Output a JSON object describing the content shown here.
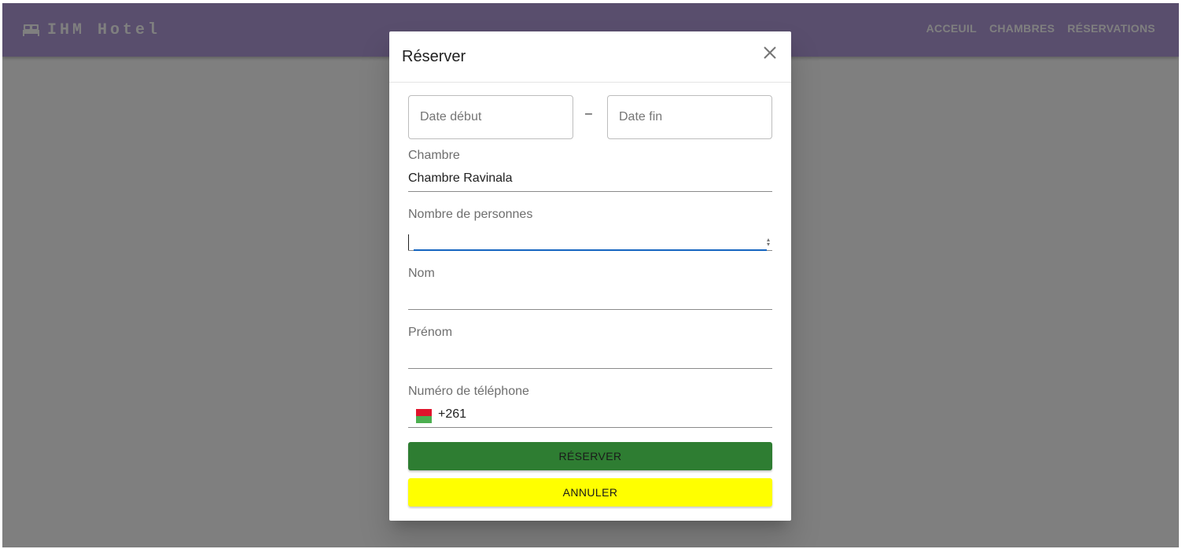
{
  "app": {
    "brand_icon": "bed-icon",
    "title": "IHM Hotel",
    "nav": [
      "ACCEUIL",
      "CHAMBRES",
      "RÉSERVATIONS"
    ]
  },
  "dialog": {
    "title": "Réserver",
    "close_icon": "close-icon",
    "date_start_placeholder": "Date début",
    "date_separator": "–",
    "date_end_placeholder": "Date fin",
    "room_label": "Chambre",
    "room_value": "Chambre Ravinala",
    "persons_label": "Nombre de personnes",
    "persons_value": "",
    "last_name_label": "Nom",
    "last_name_value": "",
    "first_name_label": "Prénom",
    "first_name_value": "",
    "phone_label": "Numéro de téléphone",
    "phone_flag_icon": "madagascar-flag-icon",
    "phone_code": "+261",
    "reserve_button": "RÉSERVER",
    "cancel_button": "ANNULER"
  },
  "colors": {
    "appbar": "#b39ddb",
    "reserve_button": "#2e7d32",
    "cancel_button": "#ffff00",
    "focus_underline": "#1565c0"
  }
}
